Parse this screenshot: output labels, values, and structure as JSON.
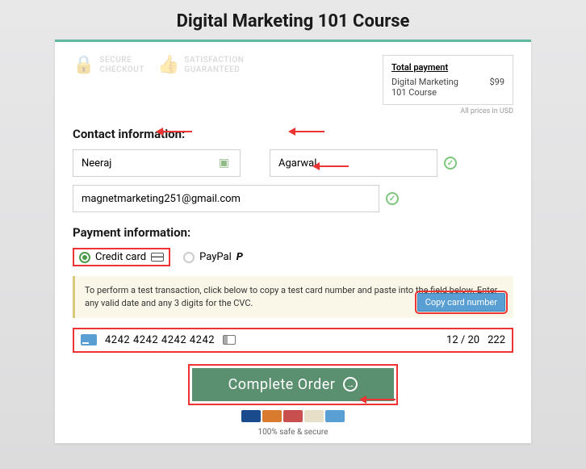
{
  "title": "Digital Marketing 101 Course",
  "badges": {
    "secure_l1": "SECURE",
    "secure_l2": "CHECKOUT",
    "sat_l1": "SATISFACTION",
    "sat_l2": "GUARANTEED"
  },
  "summary": {
    "title": "Total payment",
    "item": "Digital Marketing 101 Course",
    "price": "$99",
    "note": "All prices in USD"
  },
  "contact": {
    "heading": "Contact information:",
    "first_name": "Neeraj",
    "last_name": "Agarwal",
    "email": "magnetmarketing251@gmail.com"
  },
  "payment": {
    "heading": "Payment information:",
    "credit_card_label": "Credit card",
    "paypal_label": "PayPal",
    "test_msg": "To perform a test transaction, click below to copy a test card number and paste into the field below. Enter any valid date and any 3 digits for the CVC.",
    "copy_btn": "Copy card number",
    "card_number": "4242 4242 4242 4242",
    "expiry": "12 / 20",
    "cvc": "222"
  },
  "cta": "Complete Order",
  "safe_text": "100% safe & secure"
}
